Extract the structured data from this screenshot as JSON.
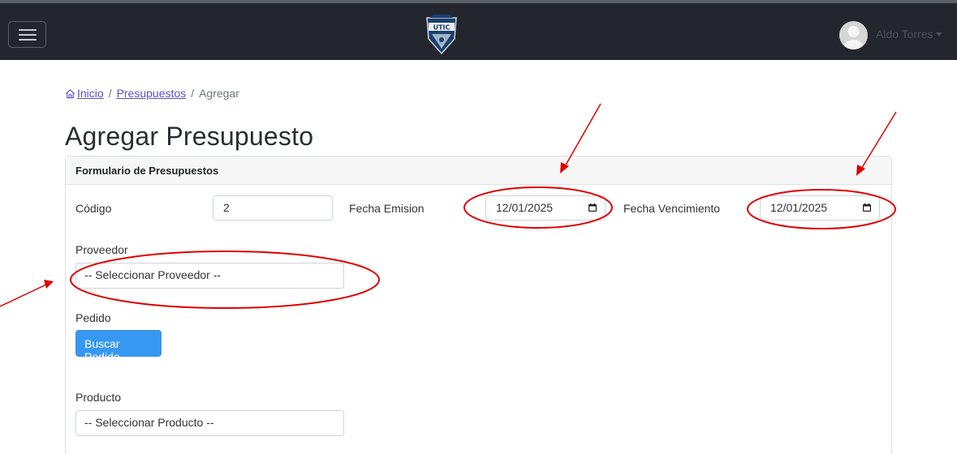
{
  "header": {
    "menu_icon": "hamburger-icon",
    "logo_text": "UTIC",
    "user_name": "Aldo Torres"
  },
  "breadcrumb": {
    "home": "Inicio",
    "section": "Presupuestos",
    "current": "Agregar",
    "separator": "/"
  },
  "page": {
    "title": "Agregar Presupuesto"
  },
  "form": {
    "header": "Formulario de Presupuestos",
    "codigo_label": "Código",
    "codigo_value": "2",
    "fecha_emision_label": "Fecha Emision",
    "fecha_emision_value": "12/01/2025",
    "fecha_vencimiento_label": "Fecha Vencimiento",
    "fecha_vencimiento_value": "12/01/2025",
    "proveedor_label": "Proveedor",
    "proveedor_value": "-- Seleccionar Proveedor --",
    "pedido_label": "Pedido",
    "buscar_pedido_label": "Buscar Pedido",
    "producto_label": "Producto",
    "producto_value": "-- Seleccionar Producto --"
  },
  "annotation_color": "#e00000"
}
